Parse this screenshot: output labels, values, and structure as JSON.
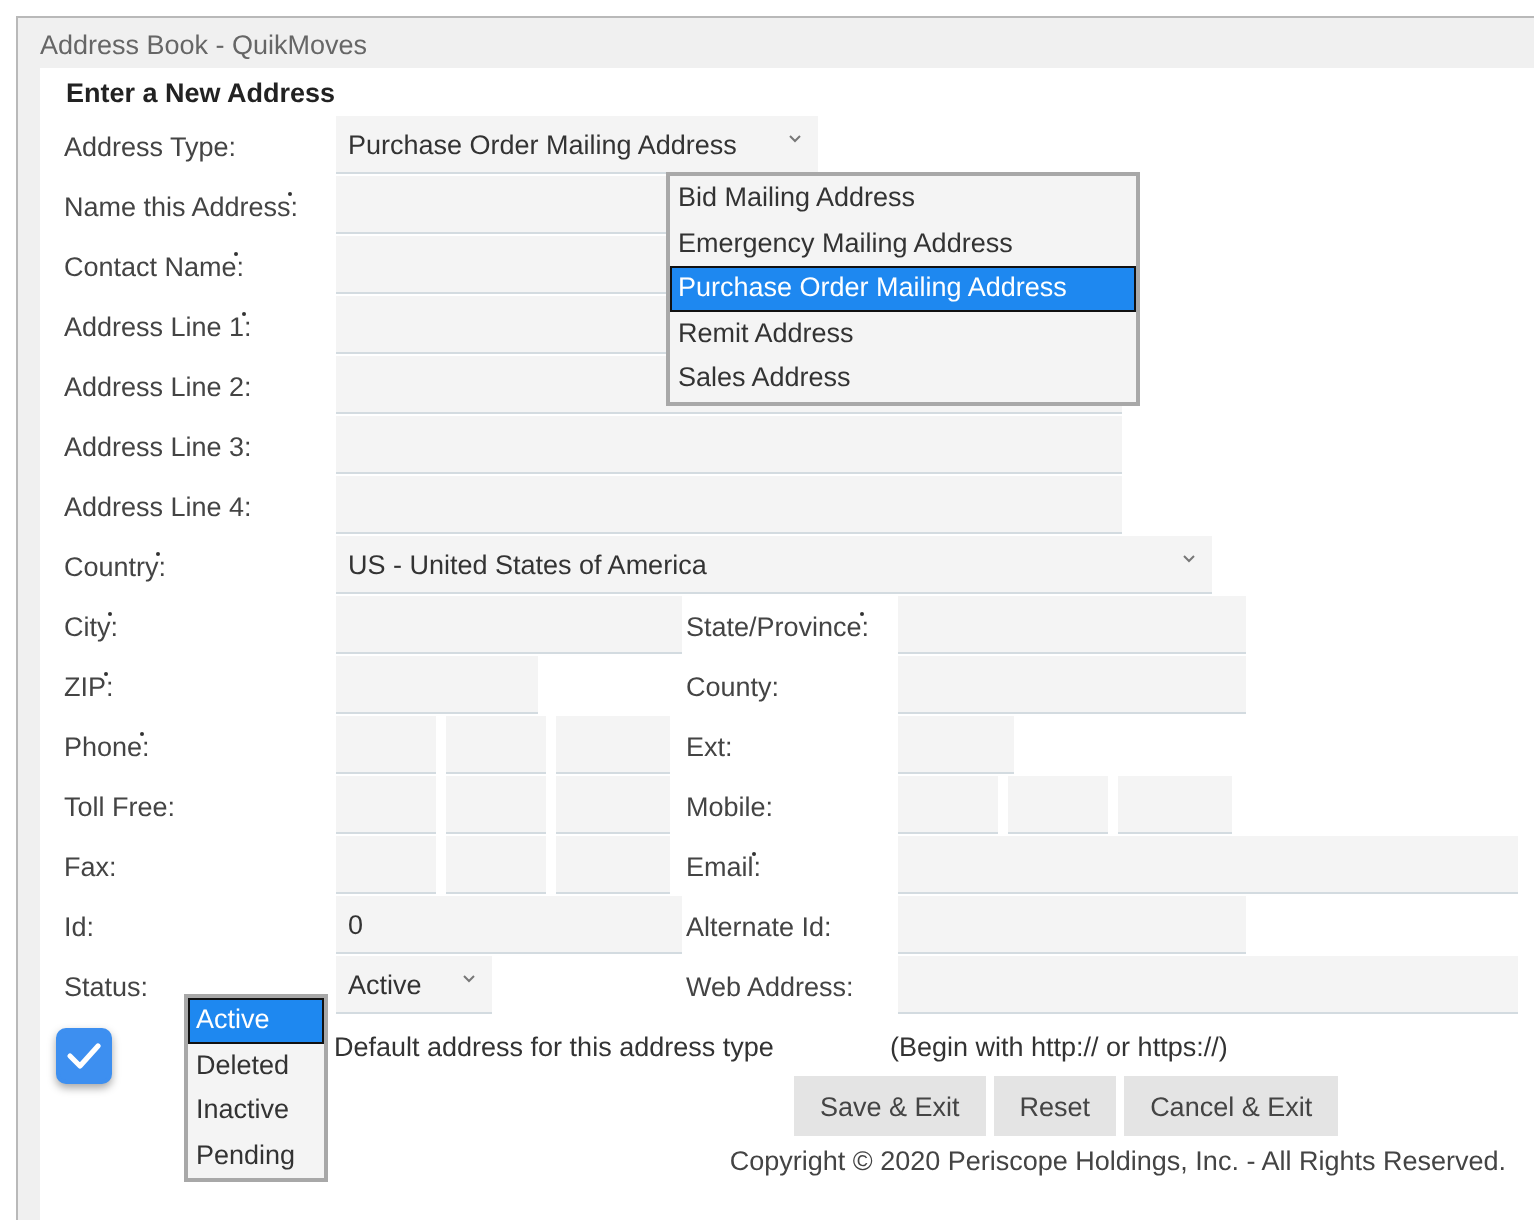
{
  "window": {
    "title": "Address Book - QuikMoves"
  },
  "form": {
    "heading": "Enter a New Address",
    "rows": [
      {
        "left": {
          "label": "Address Type:",
          "required": false,
          "kind": "select",
          "value": "Purchase Order Mailing Address"
        }
      },
      {
        "left": {
          "label": "Name this Address:",
          "required": true,
          "kind": "text"
        }
      },
      {
        "left": {
          "label": "Contact Name:",
          "required": true,
          "kind": "text"
        }
      },
      {
        "left": {
          "label": "Address Line 1:",
          "required": true,
          "kind": "text"
        }
      },
      {
        "left": {
          "label": "Address Line 2:",
          "required": false,
          "kind": "text"
        }
      },
      {
        "left": {
          "label": "Address Line 3:",
          "required": false,
          "kind": "text"
        }
      },
      {
        "left": {
          "label": "Address Line 4:",
          "required": false,
          "kind": "text"
        }
      },
      {
        "left": {
          "label": "Country:",
          "required": true,
          "kind": "select",
          "value": "US - United States of America"
        }
      },
      {
        "left": {
          "label": "City:",
          "required": true,
          "kind": "text"
        },
        "right": {
          "label": "State/Province:",
          "required": true,
          "kind": "text"
        }
      },
      {
        "left": {
          "label": "ZIP:",
          "required": true,
          "kind": "text"
        },
        "right": {
          "label": "County:",
          "required": false,
          "kind": "text"
        }
      },
      {
        "left": {
          "label": "Phone:",
          "required": true,
          "kind": "phone"
        },
        "right": {
          "label": "Ext:",
          "required": false,
          "kind": "text"
        }
      },
      {
        "left": {
          "label": "Toll Free:",
          "required": false,
          "kind": "phone"
        },
        "right": {
          "label": "Mobile:",
          "required": false,
          "kind": "phone"
        }
      },
      {
        "left": {
          "label": "Fax:",
          "required": false,
          "kind": "phone"
        },
        "right": {
          "label": "Email:",
          "required": true,
          "kind": "text"
        }
      },
      {
        "left": {
          "label": "Id:",
          "required": false,
          "kind": "text",
          "value": "0"
        },
        "right": {
          "label": "Alternate Id:",
          "required": false,
          "kind": "text"
        }
      },
      {
        "left": {
          "label": "Status:",
          "required": false,
          "kind": "select",
          "value": "Active"
        },
        "right": {
          "label": "Web Address:",
          "required": false,
          "kind": "text"
        }
      }
    ],
    "address_type_options": [
      {
        "label": "Bid Mailing Address",
        "selected": false
      },
      {
        "label": "Emergency Mailing Address",
        "selected": false
      },
      {
        "label": "Purchase Order Mailing Address",
        "selected": true
      },
      {
        "label": "Remit Address",
        "selected": false
      },
      {
        "label": "Sales Address",
        "selected": false
      }
    ],
    "status_options": [
      {
        "label": "Active",
        "selected": true
      },
      {
        "label": "Deleted",
        "selected": false
      },
      {
        "label": "Inactive",
        "selected": false
      },
      {
        "label": "Pending",
        "selected": false
      }
    ],
    "default_checkbox": {
      "label": "Default address for this address type",
      "checked": true
    },
    "web_hint": "(Begin with http:// or https://)",
    "buttons": [
      "Save & Exit",
      "Reset",
      "Cancel & Exit"
    ],
    "copyright": "Copyright © 2020 Periscope Holdings, Inc. - All Rights Reserved."
  }
}
